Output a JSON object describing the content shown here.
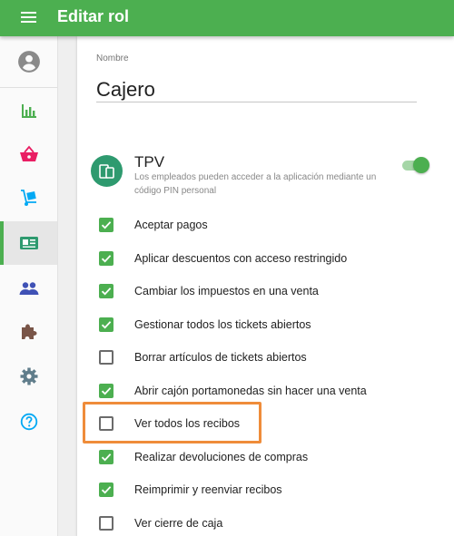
{
  "header": {
    "title": "Editar rol",
    "menu_icon": "hamburger-menu-icon"
  },
  "sidebar": {
    "items": [
      {
        "icon": "account-circle-icon",
        "color": "#8a8a8a",
        "active": false
      },
      {
        "icon": "bar-chart-icon",
        "color": "#4caf50",
        "active": false
      },
      {
        "icon": "shopping-basket-icon",
        "color": "#e91e63",
        "active": false
      },
      {
        "icon": "dolly-cart-icon",
        "color": "#03a9f4",
        "active": false
      },
      {
        "icon": "badge-card-icon",
        "color": "#2e9a6f",
        "active": true
      },
      {
        "icon": "people-icon",
        "color": "#3f51b5",
        "active": false
      },
      {
        "icon": "puzzle-icon",
        "color": "#795548",
        "active": false
      },
      {
        "icon": "settings-gear-icon",
        "color": "#607d8b",
        "active": false
      },
      {
        "icon": "help-circle-icon",
        "color": "#03a9f4",
        "active": false
      }
    ]
  },
  "form": {
    "name_label": "Nombre",
    "name_value": "Cajero"
  },
  "tpv": {
    "title": "TPV",
    "description": "Los empleados pueden acceder a la aplicación mediante un código PIN personal",
    "enabled": true,
    "icon": "pos-devices-icon"
  },
  "permissions": [
    {
      "label": "Aceptar pagos",
      "checked": true
    },
    {
      "label": "Aplicar descuentos con acceso restringido",
      "checked": true
    },
    {
      "label": "Cambiar los impuestos en una venta",
      "checked": true
    },
    {
      "label": "Gestionar todos los tickets abiertos",
      "checked": true
    },
    {
      "label": "Borrar artículos de tickets abiertos",
      "checked": false
    },
    {
      "label": "Abrir cajón portamonedas sin hacer una venta",
      "checked": true
    },
    {
      "label": "Ver todos los recibos",
      "checked": false,
      "highlighted": true
    },
    {
      "label": "Realizar devoluciones de compras",
      "checked": true
    },
    {
      "label": "Reimprimir y reenviar recibos",
      "checked": true
    },
    {
      "label": "Ver cierre de caja",
      "checked": false
    }
  ],
  "colors": {
    "primary": "#4caf50",
    "highlight": "#ef8c3a"
  }
}
